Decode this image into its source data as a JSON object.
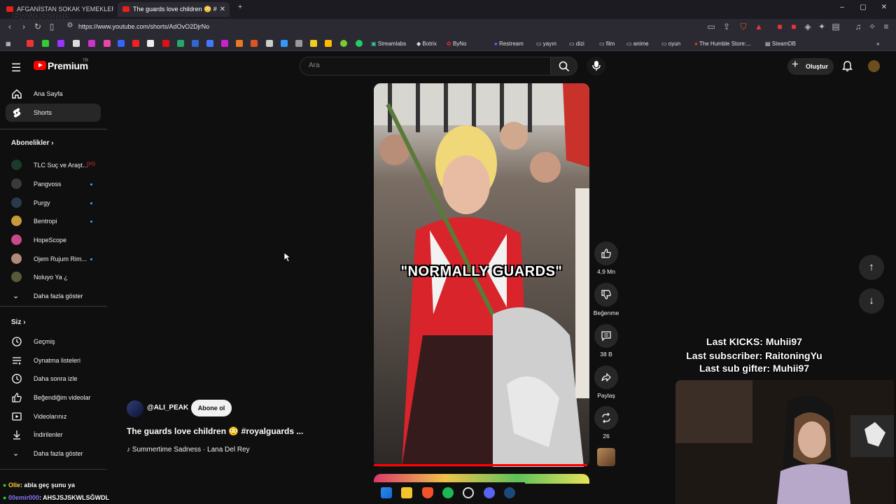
{
  "browser": {
    "tabs": [
      {
        "label": "AFGANİSTAN SOKAK YEMEKLERİNE",
        "active": false
      },
      {
        "label": "The guards love children 😳 #",
        "active": true
      }
    ],
    "url": "https://www.youtube.com/shorts/AdOvO2DjrNo",
    "watermark": "ByNoGame",
    "bookmarks": [
      "Streamlabs",
      "Botrix",
      "ByNo",
      "Restream",
      "yayın",
      "dizi",
      "film",
      "anime",
      "oyun",
      "The Humble Store:...",
      "SteamDB"
    ]
  },
  "header": {
    "logo": "Premium",
    "logo_sup": "TR",
    "search_placeholder": "Ara",
    "create_label": "Oluştur"
  },
  "sidebar": {
    "main": [
      {
        "label": "Ana Sayfa",
        "icon": "home-icon"
      },
      {
        "label": "Shorts",
        "icon": "shorts-icon",
        "active": true
      }
    ],
    "subscriptions_title": "Abonelikler",
    "subscriptions": [
      {
        "label": "TLC Suç ve Araşt...",
        "color": "#1c3a2a"
      },
      {
        "label": "Pangvoss",
        "color": "#3a3a3a"
      },
      {
        "label": "Purgy",
        "color": "#2a3a4a"
      },
      {
        "label": "Bentropi",
        "color": "#c99a3a"
      },
      {
        "label": "HopeScope",
        "color": "#c94a8a"
      },
      {
        "label": "Ojem Rujum Rim...",
        "color": "#b08a7a"
      },
      {
        "label": "Noluyo Ya ¿",
        "color": "#5a5a3a"
      }
    ],
    "show_more": "Daha fazla göster",
    "you_title": "Siz",
    "you": [
      {
        "label": "Geçmiş",
        "icon": "history-icon"
      },
      {
        "label": "Oynatma listeleri",
        "icon": "playlists-icon"
      },
      {
        "label": "Daha sonra izle",
        "icon": "clock-icon"
      },
      {
        "label": "Beğendiğim videolar",
        "icon": "thumbs-up-icon"
      },
      {
        "label": "Videolarınız",
        "icon": "your-videos-icon"
      },
      {
        "label": "İndirilenler",
        "icon": "download-icon"
      }
    ],
    "show_more_2": "Daha fazla göster"
  },
  "short": {
    "caption": "\"NORMALLY GUARDS\"",
    "channel": "@ALI_PEAK",
    "subscribe": "Abone ol",
    "title": "The guards love children 😳 #royalguards ...",
    "music": "♪ Summertime Sadness · Lana Del Rey",
    "progress": 0.99
  },
  "actions": {
    "likes": "4,9 Mn",
    "dislike": "Beğenme",
    "comments": "38 B",
    "share": "Paylaş",
    "remix": "26"
  },
  "stream": {
    "last_kicks": "Last KICKS: Muhii97",
    "last_subscriber": "Last subscriber: RaitoningYu",
    "last_sub_gifter": "Last sub gifter: Muhii97",
    "chat": [
      {
        "user": "Olle",
        "text": ": abla geç şunu ya",
        "color": "#ffd23f"
      },
      {
        "user": "00emir000",
        "text": ": AHSJSJSKWLSĞWDL",
        "color": "#8a7bff"
      }
    ]
  }
}
